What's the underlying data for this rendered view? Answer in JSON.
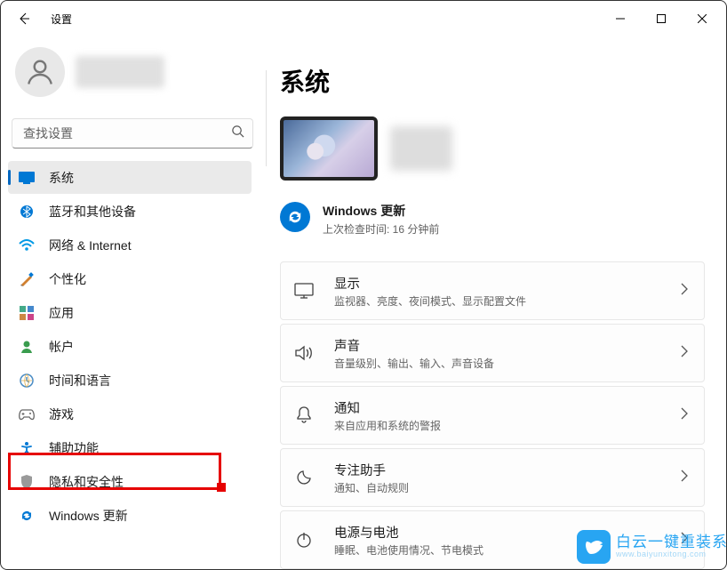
{
  "app": {
    "title": "设置"
  },
  "search": {
    "placeholder": "查找设置"
  },
  "sidebar": {
    "items": [
      {
        "label": "系统",
        "icon": "system"
      },
      {
        "label": "蓝牙和其他设备",
        "icon": "bluetooth"
      },
      {
        "label": "网络 & Internet",
        "icon": "network"
      },
      {
        "label": "个性化",
        "icon": "personalize"
      },
      {
        "label": "应用",
        "icon": "apps"
      },
      {
        "label": "帐户",
        "icon": "account"
      },
      {
        "label": "时间和语言",
        "icon": "time"
      },
      {
        "label": "游戏",
        "icon": "gaming"
      },
      {
        "label": "辅助功能",
        "icon": "accessibility"
      },
      {
        "label": "隐私和安全性",
        "icon": "privacy"
      },
      {
        "label": "Windows 更新",
        "icon": "update"
      }
    ],
    "selected_index": 0,
    "highlighted_index": 8
  },
  "page": {
    "title": "系统",
    "update": {
      "title": "Windows 更新",
      "subtitle": "上次检查时间: 16 分钟前"
    },
    "cards": [
      {
        "key": "display",
        "title": "显示",
        "sub": "监视器、亮度、夜间模式、显示配置文件"
      },
      {
        "key": "sound",
        "title": "声音",
        "sub": "音量级别、输出、输入、声音设备"
      },
      {
        "key": "notifications",
        "title": "通知",
        "sub": "来自应用和系统的警报"
      },
      {
        "key": "focus",
        "title": "专注助手",
        "sub": "通知、自动规则"
      },
      {
        "key": "power",
        "title": "电源与电池",
        "sub": "睡眠、电池使用情况、节电模式"
      }
    ]
  },
  "watermark": {
    "main": "白云一键重装系统",
    "sub": "www.baiyunxitong.com"
  }
}
